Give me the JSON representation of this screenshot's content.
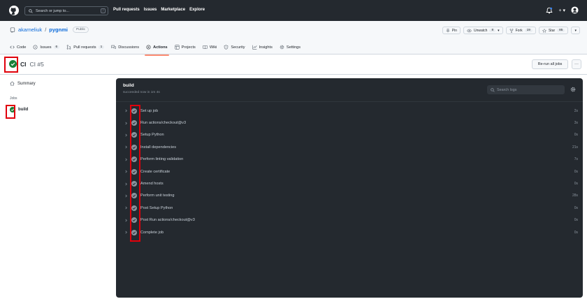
{
  "header": {
    "search_placeholder": "Search or jump to...",
    "search_key": "/",
    "nav": [
      "Pull requests",
      "Issues",
      "Marketplace",
      "Explore"
    ],
    "plus_label": "+ ▾"
  },
  "repo": {
    "owner": "akarneliuk",
    "separator": "/",
    "name": "pygnmi",
    "visibility": "Public",
    "pin_label": "Pin",
    "unwatch_label": "Unwatch",
    "unwatch_count": "8",
    "fork_label": "Fork",
    "fork_count": "19",
    "star_label": "Star",
    "star_count": "85",
    "dropdown": "▾"
  },
  "tabs": [
    {
      "label": "Code",
      "count": ""
    },
    {
      "label": "Issues",
      "count": "6"
    },
    {
      "label": "Pull requests",
      "count": "1"
    },
    {
      "label": "Discussions",
      "count": ""
    },
    {
      "label": "Actions",
      "count": ""
    },
    {
      "label": "Projects",
      "count": ""
    },
    {
      "label": "Wiki",
      "count": ""
    },
    {
      "label": "Security",
      "count": ""
    },
    {
      "label": "Insights",
      "count": ""
    },
    {
      "label": "Settings",
      "count": ""
    }
  ],
  "run": {
    "workflow": "CI",
    "number": "CI #5",
    "rerun_label": "Re-run all jobs",
    "more_label": "···"
  },
  "sidebar": {
    "summary_label": "Summary",
    "jobs_heading": "Jobs",
    "job_name": "build"
  },
  "job": {
    "title": "build",
    "subtitle": "succeeded now in 1m 4s",
    "search_placeholder": "Search logs",
    "steps": [
      {
        "name": "Set up job",
        "time": "2s"
      },
      {
        "name": "Run actions/checkout@v3",
        "time": "3s"
      },
      {
        "name": "Setup Python",
        "time": "0s"
      },
      {
        "name": "Install dependencies",
        "time": "21s"
      },
      {
        "name": "Perform linting validation",
        "time": "7s"
      },
      {
        "name": "Create certificate",
        "time": "0s"
      },
      {
        "name": "Amend hosts",
        "time": "0s"
      },
      {
        "name": "Perform unit testing",
        "time": "28s"
      },
      {
        "name": "Post Setup Python",
        "time": "0s"
      },
      {
        "name": "Post Run actions/checkout@v3",
        "time": "0s"
      },
      {
        "name": "Complete job",
        "time": "0s"
      }
    ]
  },
  "colors": {
    "success": "#1a7f37",
    "highlight": "#e0000b",
    "header_bg": "#24292f",
    "link": "#0969da"
  }
}
